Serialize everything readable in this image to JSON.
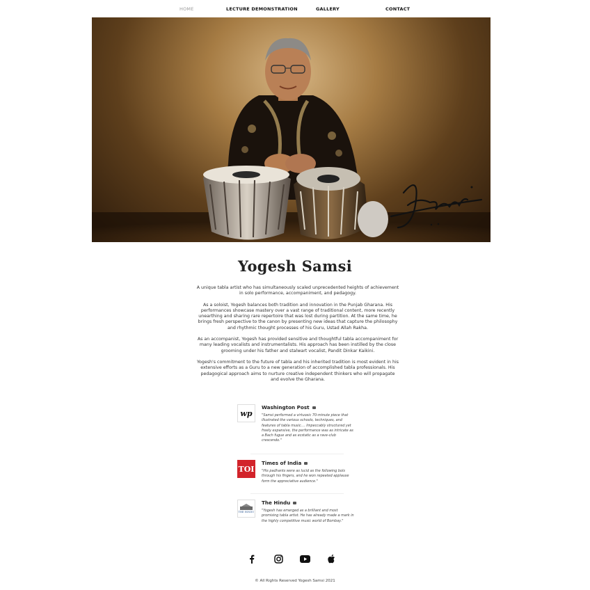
{
  "nav": {
    "items": [
      {
        "label": "HOME",
        "active": true
      },
      {
        "label": "LECTURE DEMONSTRATION",
        "active": false
      },
      {
        "label": "GALLERY",
        "active": false
      },
      {
        "label": "CONTACT",
        "active": false
      }
    ]
  },
  "hero": {
    "signature_text": "Samsi"
  },
  "main": {
    "title": "Yogesh Samsi",
    "bio": [
      "A unique tabla artist who has simultaneously scaled unprecedented heights of achievement in solo performance, accompaniment, and pedagogy.",
      "As a soloist, Yogesh balances both tradition and innovation in the Punjab Gharana. His performances showcase mastery over a vast range of traditional content, more recently unearthing and sharing rare repertoire that was lost during partition. At the same time, he brings fresh perspective to the canon by presenting new ideas that capture the philosophy and rhythmic thought processes of his Guru, Ustad Allah Rakha.",
      "As an accompanist, Yogesh has provided sensitive and thoughtful tabla accompaniment for many leading vocalists and instrumentalists. His approach has been instilled by the close grooming under his father and stalwart vocalist, Pandit Dinkar Kaikini.",
      "Yogesh's commitment to the future of tabla and his inherited tradition is most evident in his extensive efforts as a Guru to a new generation of accomplished tabla professionals. His pedagogical approach aims to nurture creative independent thinkers who will propagate and evolve the Gharana."
    ]
  },
  "press": [
    {
      "name": "Washington Post",
      "logo_text": "wp",
      "quote": "\"Samsi performed a virtuosic 70-minute piece that illustrated the various schools, techniques, and features  of tabla music.... Impeccably structured yet freely expansive, the performance was as intricate as a Bach fugue and as ecstatic as a rave-club crescendo.\""
    },
    {
      "name": "Times of India",
      "logo_text": "TOI",
      "quote": "\"His padhants were as lucid as the following bols through his fingers, and he won repeated applause form the appreciative audience.\""
    },
    {
      "name": "The Hindu",
      "logo_text": "THE HINDU",
      "quote": "\"Yogesh has emerged as a brilliant and most promising tabla artist. He has already made a mark in the highly competitive music world of Bombay.\""
    }
  ],
  "social": [
    {
      "icon": "facebook-icon"
    },
    {
      "icon": "instagram-icon"
    },
    {
      "icon": "youtube-icon"
    },
    {
      "icon": "apple-icon"
    }
  ],
  "footer": {
    "copyright": "© All Rights Reserved Yogesh Samsi 2021"
  }
}
